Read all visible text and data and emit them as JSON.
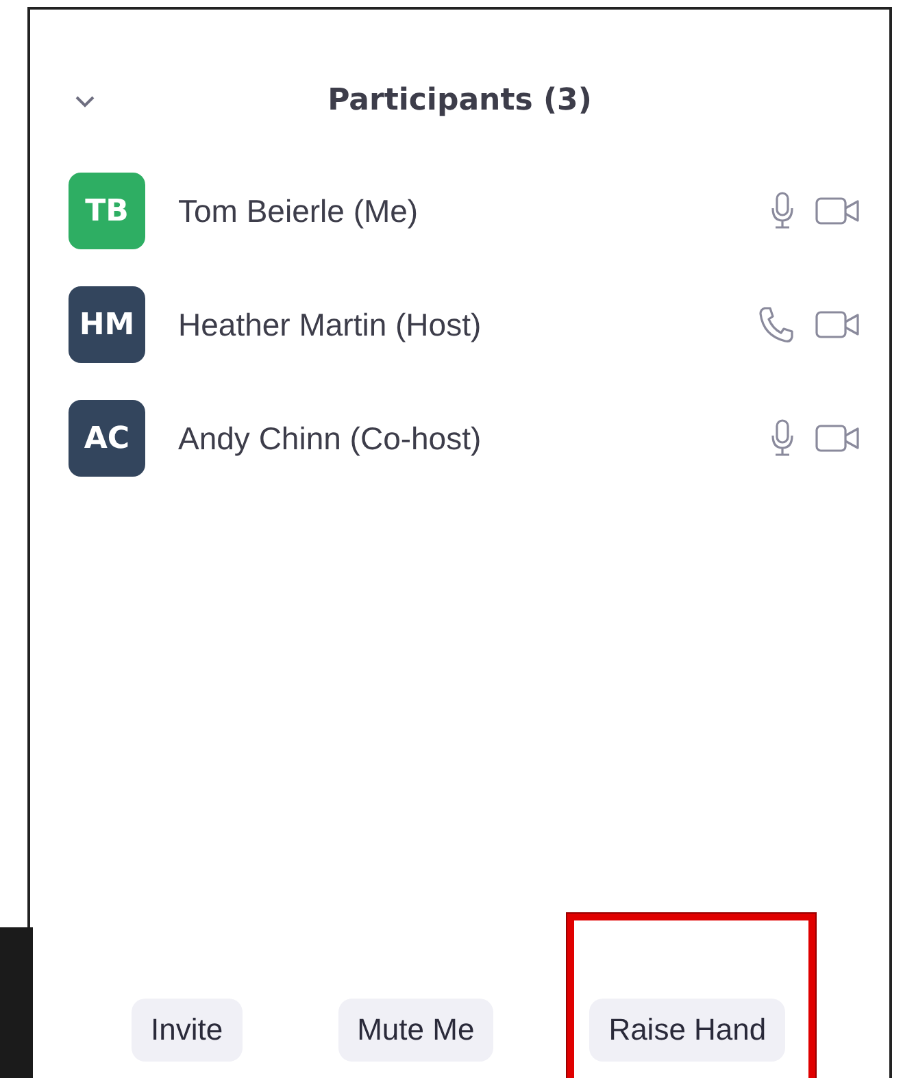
{
  "panel": {
    "title": "Participants (3)",
    "collapsed": false
  },
  "participants": [
    {
      "initials": "TB",
      "name": "Tom Beierle (Me)",
      "color": "#2eae63",
      "audio": {
        "kind": "mic"
      },
      "video": true
    },
    {
      "initials": "HM",
      "name": "Heather Martin (Host)",
      "color": "#33455d",
      "audio": {
        "kind": "phone"
      },
      "video": true
    },
    {
      "initials": "AC",
      "name": "Andy Chinn (Co-host)",
      "color": "#33455d",
      "audio": {
        "kind": "mic"
      },
      "video": true
    }
  ],
  "buttons": [
    {
      "label": "Invite",
      "highlighted": false
    },
    {
      "label": "Mute Me",
      "highlighted": false
    },
    {
      "label": "Raise Hand",
      "highlighted": true
    }
  ]
}
